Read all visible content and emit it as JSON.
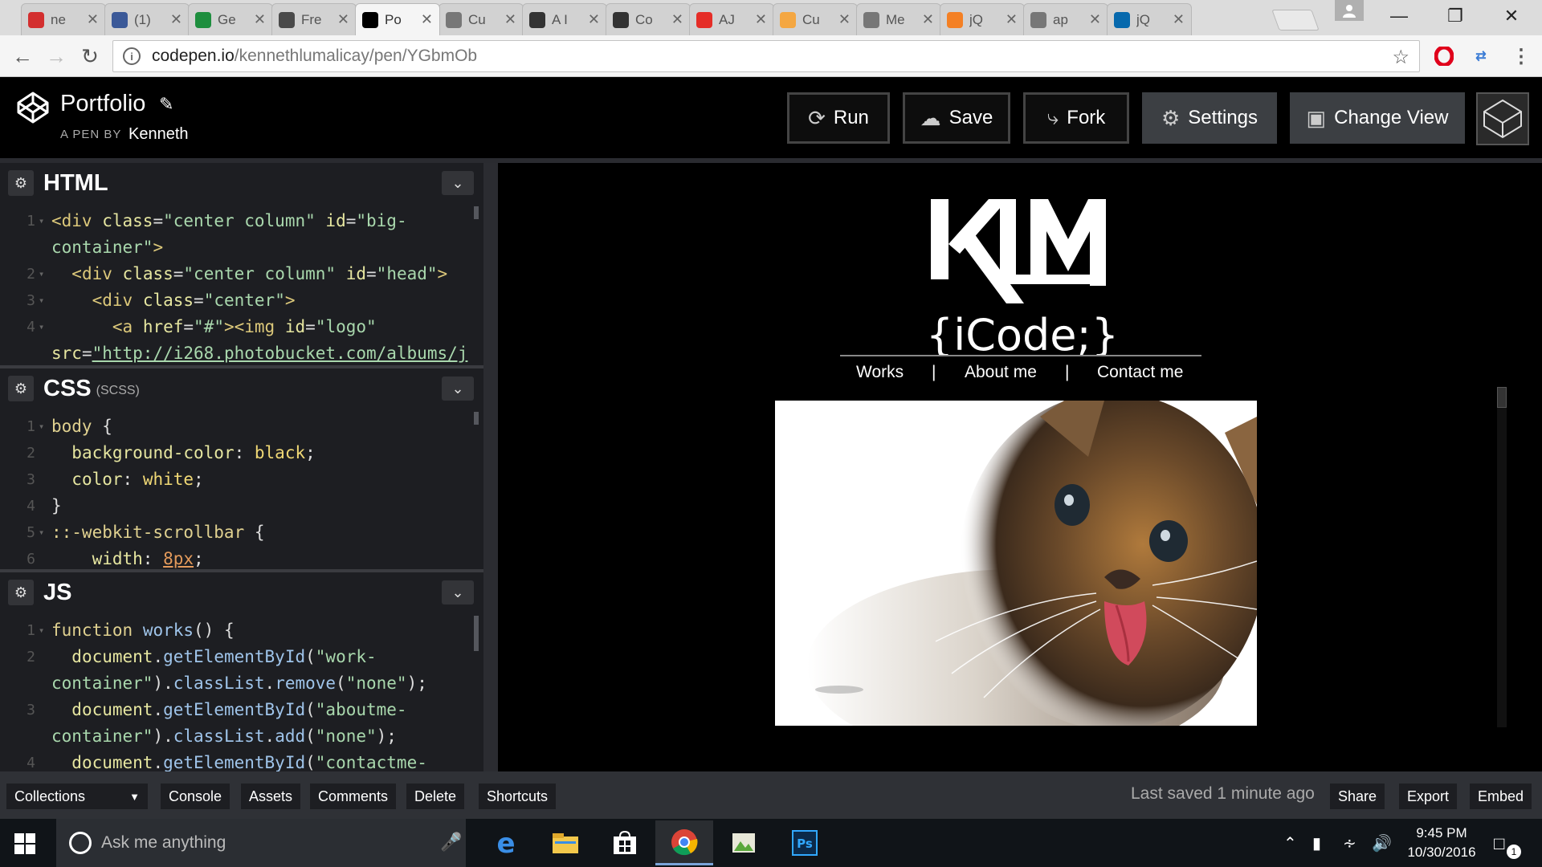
{
  "browser": {
    "tabs": [
      {
        "title": "ne",
        "icon": "pokeball-icon",
        "color": "#d32f2f"
      },
      {
        "title": "(1)",
        "icon": "facebook-icon",
        "color": "#3b5998"
      },
      {
        "title": "Ge",
        "icon": "sheets-icon",
        "color": "#1e8e3e"
      },
      {
        "title": "Fre",
        "icon": "freecodecamp-icon",
        "color": "#4a4a4a"
      },
      {
        "title": "Po",
        "icon": "codepen-icon",
        "color": "#000000",
        "active": true
      },
      {
        "title": "Cu",
        "icon": "camera-icon",
        "color": "#777777"
      },
      {
        "title": "A I",
        "icon": "codepen-icon",
        "color": "#333333"
      },
      {
        "title": "Co",
        "icon": "codepen-icon",
        "color": "#333333"
      },
      {
        "title": "AJ",
        "icon": "youtube-icon",
        "color": "#e52d27"
      },
      {
        "title": "Cu",
        "icon": "sun-icon",
        "color": "#f4a742"
      },
      {
        "title": "Me",
        "icon": "document-icon",
        "color": "#777777"
      },
      {
        "title": "jQ",
        "icon": "stackoverflow-icon",
        "color": "#f48024"
      },
      {
        "title": "ap",
        "icon": "document-icon",
        "color": "#777777"
      },
      {
        "title": "jQ",
        "icon": "jquery-icon",
        "color": "#0769ad"
      }
    ],
    "url_host": "codepen.io",
    "url_path": "/kennethlumalicay/pen/YGbmOb"
  },
  "header": {
    "pen_title": "Portfolio",
    "pen_by": "A PEN BY",
    "author": "Kenneth",
    "buttons": {
      "run": "Run",
      "save": "Save",
      "fork": "Fork",
      "settings": "Settings",
      "change_view": "Change View"
    }
  },
  "editors": {
    "html": {
      "name": "HTML",
      "sub": ""
    },
    "css": {
      "name": "CSS",
      "sub": "(SCSS)"
    },
    "js": {
      "name": "JS",
      "sub": ""
    }
  },
  "preview": {
    "logo_text": "KLM",
    "logo_tagline": "{iCode;}",
    "nav": [
      "Works",
      "About me",
      "Contact me"
    ],
    "nav_separator": "|"
  },
  "footer": {
    "collections": "Collections",
    "console": "Console",
    "assets": "Assets",
    "comments": "Comments",
    "delete": "Delete",
    "shortcuts": "Shortcuts",
    "last_saved": "Last saved 1 minute ago",
    "share": "Share",
    "export": "Export",
    "embed": "Embed"
  },
  "taskbar": {
    "search_placeholder": "Ask me anything",
    "time": "9:45 PM",
    "date": "10/30/2016",
    "notification_count": "1"
  }
}
